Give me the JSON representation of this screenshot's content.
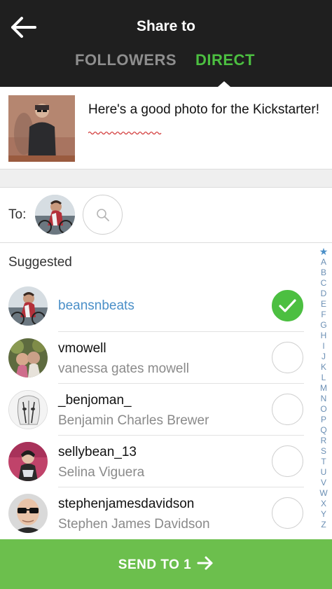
{
  "header": {
    "title": "Share to",
    "tabs": [
      {
        "label": "FOLLOWERS",
        "active": false
      },
      {
        "label": "DIRECT",
        "active": true
      }
    ],
    "back_icon": "arrow-left-icon"
  },
  "caption": {
    "text": "Here's a good photo for the Kickstarter!",
    "photo_icon": "photo-thumbnail"
  },
  "to": {
    "label": "To:",
    "search_icon": "search-icon"
  },
  "suggested": {
    "label": "Suggested",
    "users": [
      {
        "username": "beansnbeats",
        "full_name": "",
        "selected": true
      },
      {
        "username": "vmowell",
        "full_name": "vanessa gates mowell",
        "selected": false
      },
      {
        "username": "_benjoman_",
        "full_name": "Benjamin Charles Brewer",
        "selected": false
      },
      {
        "username": "sellybean_13",
        "full_name": "Selina Viguera",
        "selected": false
      },
      {
        "username": "stephenjamesdavidson",
        "full_name": "Stephen James Davidson",
        "selected": false
      }
    ]
  },
  "alphabet_index": [
    "★",
    "A",
    "B",
    "C",
    "D",
    "E",
    "F",
    "G",
    "H",
    "I",
    "J",
    "K",
    "L",
    "M",
    "N",
    "O",
    "P",
    "Q",
    "R",
    "S",
    "T",
    "U",
    "V",
    "W",
    "X",
    "Y",
    "Z"
  ],
  "send_button": {
    "label": "SEND TO 1"
  },
  "colors": {
    "header_bg": "#1f1f1f",
    "accent_green": "#4cbf41",
    "send_bar": "#6cbf4d",
    "link_blue": "#4a8fc8",
    "index_blue": "#6b8fb4"
  }
}
